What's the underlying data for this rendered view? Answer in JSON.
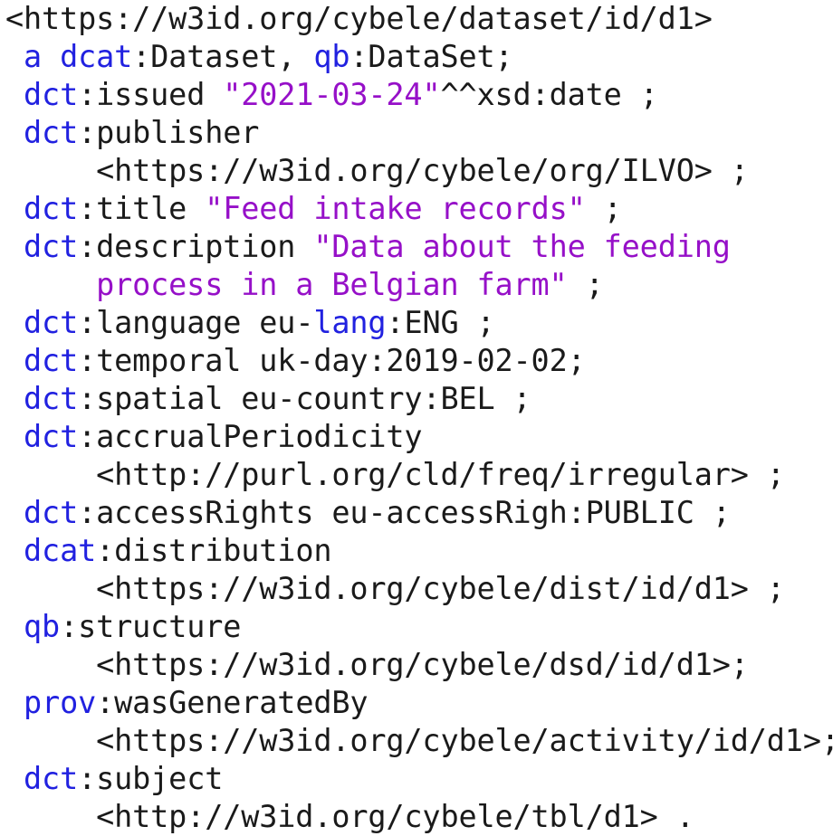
{
  "document": {
    "kind": "rdf-turtle-code-listing",
    "language": "Turtle (TTL)",
    "subject_iri": "<https://w3id.org/cybele/dataset/id/d1>",
    "background_color": "#ffffff",
    "colors": {
      "prefix": "#2121e0",
      "literal": "#9610c8",
      "plain": "#1a1a1a"
    },
    "line_count": 21,
    "plain_text": "<https://w3id.org/cybele/dataset/id/d1>\n a dcat:Dataset, qb:DataSet;\n dct:issued \"2021-03-24\"^^xsd:date ;\n dct:publisher\n     <https://w3id.org/cybele/org/ILVO> ;\n dct:title \"Feed intake records\" ;\n dct:description \"Data about the feeding\n     process in a Belgian farm\" ;\n dct:language eu-lang:ENG ;\n dct:temporal uk-day:2019-02-02;\n dct:spatial eu-country:BEL ;\n dct:accrualPeriodicity\n     <http://purl.org/cld/freq/irregular> ;\n dct:accessRights eu-accessRigh:PUBLIC ;\n dcat:distribution\n     <https://w3id.org/cybele/dist/id/d1> ;\n qb:structure\n     <https://w3id.org/cybele/dsd/id/d1>;\n prov:wasGeneratedBy\n     <https://w3id.org/cybele/activity/id/d1>;\n dct:subject\n     <http://w3id.org/cybele/tbl/d1> ."
  },
  "lines": [
    {
      "id": "line-1",
      "tokens": [
        {
          "t": "<https://w3id.org/cybele/dataset/id/d1>",
          "c": "plain"
        }
      ]
    },
    {
      "id": "line-2",
      "tokens": [
        {
          "t": " ",
          "c": "plain"
        },
        {
          "t": "a",
          "c": "prefix"
        },
        {
          "t": " ",
          "c": "plain"
        },
        {
          "t": "dcat",
          "c": "prefix"
        },
        {
          "t": ":Dataset, ",
          "c": "plain"
        },
        {
          "t": "qb",
          "c": "prefix"
        },
        {
          "t": ":DataSet;",
          "c": "plain"
        }
      ]
    },
    {
      "id": "line-3",
      "tokens": [
        {
          "t": " ",
          "c": "plain"
        },
        {
          "t": "dct",
          "c": "prefix"
        },
        {
          "t": ":issued ",
          "c": "plain"
        },
        {
          "t": "\"2021-03-24\"",
          "c": "literal"
        },
        {
          "t": "^^xsd:date ;",
          "c": "plain"
        }
      ]
    },
    {
      "id": "line-4",
      "tokens": [
        {
          "t": " ",
          "c": "plain"
        },
        {
          "t": "dct",
          "c": "prefix"
        },
        {
          "t": ":publisher",
          "c": "plain"
        }
      ]
    },
    {
      "id": "line-5",
      "tokens": [
        {
          "t": "     <https://w3id.org/cybele/org/ILVO> ;",
          "c": "plain"
        }
      ]
    },
    {
      "id": "line-6",
      "tokens": [
        {
          "t": " ",
          "c": "plain"
        },
        {
          "t": "dct",
          "c": "prefix"
        },
        {
          "t": ":title ",
          "c": "plain"
        },
        {
          "t": "\"Feed intake records\"",
          "c": "literal"
        },
        {
          "t": " ;",
          "c": "plain"
        }
      ]
    },
    {
      "id": "line-7",
      "tokens": [
        {
          "t": " ",
          "c": "plain"
        },
        {
          "t": "dct",
          "c": "prefix"
        },
        {
          "t": ":description ",
          "c": "plain"
        },
        {
          "t": "\"Data about the feeding",
          "c": "literal"
        }
      ]
    },
    {
      "id": "line-8",
      "tokens": [
        {
          "t": "     ",
          "c": "plain"
        },
        {
          "t": "process in a Belgian farm\"",
          "c": "literal"
        },
        {
          "t": " ;",
          "c": "plain"
        }
      ]
    },
    {
      "id": "line-9",
      "tokens": [
        {
          "t": " ",
          "c": "plain"
        },
        {
          "t": "dct",
          "c": "prefix"
        },
        {
          "t": ":language eu-",
          "c": "plain"
        },
        {
          "t": "lang",
          "c": "prefix"
        },
        {
          "t": ":ENG ;",
          "c": "plain"
        }
      ]
    },
    {
      "id": "line-10",
      "tokens": [
        {
          "t": " ",
          "c": "plain"
        },
        {
          "t": "dct",
          "c": "prefix"
        },
        {
          "t": ":temporal uk-day:2019-02-02;",
          "c": "plain"
        }
      ]
    },
    {
      "id": "line-11",
      "tokens": [
        {
          "t": " ",
          "c": "plain"
        },
        {
          "t": "dct",
          "c": "prefix"
        },
        {
          "t": ":spatial eu-country:BEL ;",
          "c": "plain"
        }
      ]
    },
    {
      "id": "line-12",
      "tokens": [
        {
          "t": " ",
          "c": "plain"
        },
        {
          "t": "dct",
          "c": "prefix"
        },
        {
          "t": ":accrualPeriodicity",
          "c": "plain"
        }
      ]
    },
    {
      "id": "line-13",
      "tokens": [
        {
          "t": "     <http://purl.org/cld/freq/irregular> ;",
          "c": "plain"
        }
      ]
    },
    {
      "id": "line-14",
      "tokens": [
        {
          "t": " ",
          "c": "plain"
        },
        {
          "t": "dct",
          "c": "prefix"
        },
        {
          "t": ":accessRights eu-accessRigh:PUBLIC ;",
          "c": "plain"
        }
      ]
    },
    {
      "id": "line-15",
      "tokens": [
        {
          "t": " ",
          "c": "plain"
        },
        {
          "t": "dcat",
          "c": "prefix"
        },
        {
          "t": ":distribution",
          "c": "plain"
        }
      ]
    },
    {
      "id": "line-16",
      "tokens": [
        {
          "t": "     <https://w3id.org/cybele/dist/id/d1> ;",
          "c": "plain"
        }
      ]
    },
    {
      "id": "line-17",
      "tokens": [
        {
          "t": " ",
          "c": "plain"
        },
        {
          "t": "qb",
          "c": "prefix"
        },
        {
          "t": ":structure",
          "c": "plain"
        }
      ]
    },
    {
      "id": "line-18",
      "tokens": [
        {
          "t": "     <https://w3id.org/cybele/dsd/id/d1>;",
          "c": "plain"
        }
      ]
    },
    {
      "id": "line-19",
      "tokens": [
        {
          "t": " ",
          "c": "plain"
        },
        {
          "t": "prov",
          "c": "prefix"
        },
        {
          "t": ":wasGeneratedBy",
          "c": "plain"
        }
      ]
    },
    {
      "id": "line-20",
      "tokens": [
        {
          "t": "     <https://w3id.org/cybele/activity/id/d1>;",
          "c": "plain"
        }
      ]
    },
    {
      "id": "line-21",
      "tokens": [
        {
          "t": " ",
          "c": "plain"
        },
        {
          "t": "dct",
          "c": "prefix"
        },
        {
          "t": ":subject",
          "c": "plain"
        }
      ]
    },
    {
      "id": "line-22",
      "tokens": [
        {
          "t": "     <http://w3id.org/cybele/tbl/d1> .",
          "c": "plain"
        }
      ]
    }
  ]
}
